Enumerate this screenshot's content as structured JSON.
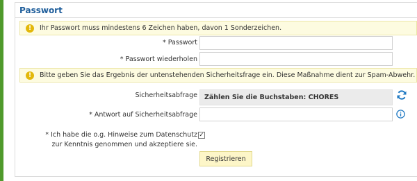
{
  "section": {
    "title": "Passwort"
  },
  "notices": {
    "password_rule": "Ihr Passwort muss mindestens 6 Zeichen haben, davon 1 Sonderzeichen.",
    "spam_question": "Bitte geben Sie das Ergebnis der untenstehenden Sicherheitsfrage ein. Diese Maßnahme dient zur Spam-Abwehr."
  },
  "fields": {
    "password_label": "* Passwort",
    "password_value": "",
    "password_repeat_label": "* Passwort wiederholen",
    "password_repeat_value": "",
    "security_question_label": "Sicherheitsabfrage",
    "security_question_text": "Zählen Sie die Buchstaben: CHORES",
    "security_answer_label": "* Antwort auf Sicherheitsabfrage",
    "security_answer_value": ""
  },
  "privacy": {
    "text": "* Ich habe die o.g. Hinweise zum Datenschutz zur Kenntnis genommen und akzeptiere sie.",
    "checked": true,
    "check_glyph": "✓"
  },
  "actions": {
    "submit_label": "Registrieren"
  },
  "icons": {
    "notice_icon": "info-icon",
    "refresh_icon": "refresh-icon",
    "help_icon": "help-icon"
  },
  "colors": {
    "accent_green": "#4f9a2b",
    "title_blue": "#1f5e9b",
    "notice_background": "#fdfbe0",
    "notice_icon": "#e3b80a",
    "icon_blue": "#1e78c2",
    "button_background": "#fdf6c8"
  }
}
